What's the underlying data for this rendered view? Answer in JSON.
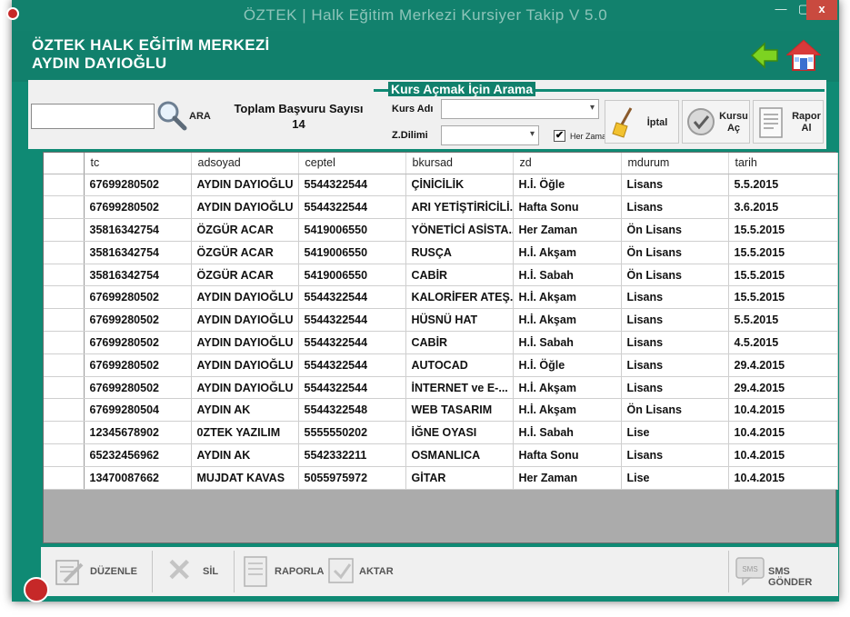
{
  "window": {
    "title": "ÖZTEK | Halk Eğitim Merkezi Kursiyer Takip V 5.0",
    "min_glyph": "—",
    "max_glyph": "▢",
    "close_glyph": "x"
  },
  "header": {
    "institution": "ÖZTEK HALK EĞİTİM MERKEZİ",
    "person": "AYDIN DAYIOĞLU",
    "back_icon": "back-arrow-icon",
    "home_icon": "home-icon"
  },
  "search": {
    "tc_value": "",
    "search_label": "ARA",
    "total_label": "Toplam Başvuru Sayısı",
    "total_count": "14"
  },
  "course_search": {
    "title": "Kurs Açmak İçin Arama",
    "course_label": "Kurs Adı",
    "course_value": "",
    "time_label": "Z.Dilimi",
    "time_value": "",
    "any_time_label": "Her Zaman",
    "any_time_checked": true,
    "check_glyph": "✔",
    "combo_arrow": "▾"
  },
  "actions": {
    "cancel": "İptal",
    "open_course_1": "Kursu",
    "open_course_2": "Aç",
    "report_1": "Rapor",
    "report_2": "Al"
  },
  "table": {
    "columns": [
      "tc",
      "adsoyad",
      "ceptel",
      "bkursad",
      "zd",
      "mdurum",
      "tarih"
    ],
    "rows": [
      [
        "67699280502",
        "AYDIN DAYIOĞLU",
        "5544322544",
        "ÇİNİCİLİK",
        "H.İ. Öğle",
        "Lisans",
        "5.5.2015"
      ],
      [
        "67699280502",
        "AYDIN DAYIOĞLU",
        "5544322544",
        "ARI YETİŞTİRİCİLİ...",
        "Hafta Sonu",
        "Lisans",
        "3.6.2015"
      ],
      [
        "35816342754",
        "ÖZGÜR ACAR",
        "5419006550",
        "YÖNETİCİ ASİSTA...",
        "Her Zaman",
        "Ön Lisans",
        "15.5.2015"
      ],
      [
        "35816342754",
        "ÖZGÜR ACAR",
        "5419006550",
        "RUSÇA",
        "H.İ. Akşam",
        "Ön Lisans",
        "15.5.2015"
      ],
      [
        "35816342754",
        "ÖZGÜR ACAR",
        "5419006550",
        "CABİR",
        "H.İ. Sabah",
        "Ön Lisans",
        "15.5.2015"
      ],
      [
        "67699280502",
        "AYDIN DAYIOĞLU",
        "5544322544",
        "KALORİFER ATEŞ...",
        "H.İ. Akşam",
        "Lisans",
        "15.5.2015"
      ],
      [
        "67699280502",
        "AYDIN DAYIOĞLU",
        "5544322544",
        "HÜSNÜ HAT",
        "H.İ. Akşam",
        "Lisans",
        "5.5.2015"
      ],
      [
        "67699280502",
        "AYDIN DAYIOĞLU",
        "5544322544",
        "CABİR",
        "H.İ. Sabah",
        "Lisans",
        "4.5.2015"
      ],
      [
        "67699280502",
        "AYDIN DAYIOĞLU",
        "5544322544",
        "AUTOCAD",
        "H.İ. Öğle",
        "Lisans",
        "29.4.2015"
      ],
      [
        "67699280502",
        "AYDIN DAYIOĞLU",
        "5544322544",
        "İNTERNET  ve E-...",
        "H.İ. Akşam",
        "Lisans",
        "29.4.2015"
      ],
      [
        "67699280504",
        "AYDIN AK",
        "5544322548",
        "WEB TASARIM",
        "H.İ. Akşam",
        "Ön Lisans",
        "10.4.2015"
      ],
      [
        "12345678902",
        "0ZTEK YAZILIM",
        "5555550202",
        "İĞNE OYASI",
        "H.İ. Sabah",
        "Lise",
        "10.4.2015"
      ],
      [
        "65232456962",
        "AYDIN  AK",
        "5542332211",
        "OSMANLICA",
        "Hafta Sonu",
        "Lisans",
        "10.4.2015"
      ],
      [
        "13470087662",
        "MUJDAT KAVAS",
        "5055975972",
        "GİTAR",
        "Her Zaman",
        "Lise",
        "10.4.2015"
      ]
    ]
  },
  "bottom": {
    "edit": "DÜZENLE",
    "delete": "SİL",
    "report": "RAPORLA",
    "transfer": "AKTAR",
    "sms": "SMS GÖNDER",
    "sms_icon_text": "SMS",
    "delete_glyph": "✕"
  },
  "colors": {
    "window_green": "#0f8a74",
    "header_green": "#11806c",
    "toolbar_gray": "#f0f0f0",
    "grid_empty": "#ababab"
  }
}
